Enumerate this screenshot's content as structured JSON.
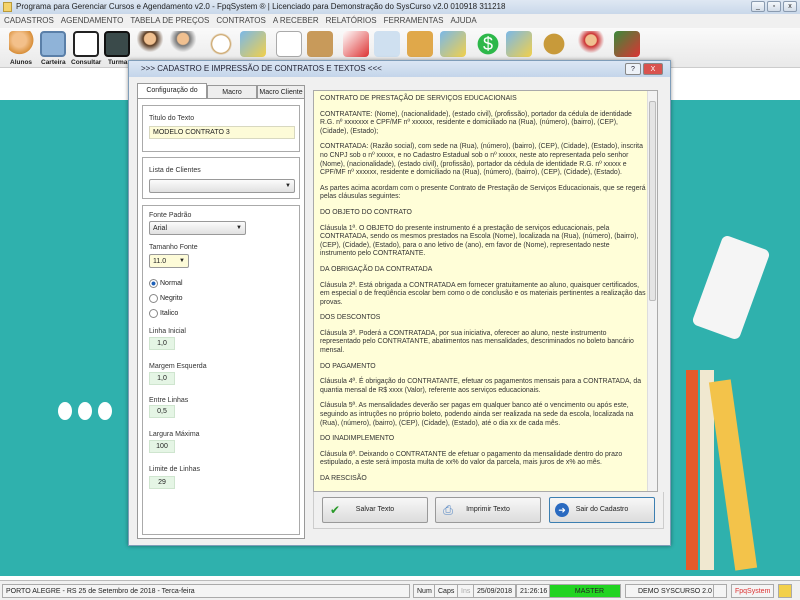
{
  "window": {
    "title": "Programa para Gerenciar Cursos e Agendamento v2.0 - FpqSystem ® | Licenciado para  Demonstração do SysCurso v2.0 010918 311218"
  },
  "menu": [
    "CADASTROS",
    "AGENDAMENTO",
    "TABELA DE PREÇOS",
    "CONTRATOS",
    "A RECEBER",
    "RELATÓRIOS",
    "FERRAMENTAS",
    "AJUDA"
  ],
  "toolbar": {
    "labels": [
      "Alunos",
      "Carteira",
      "Consultar",
      "Turma"
    ]
  },
  "dialog": {
    "title": ">>>  CADASTRO E IMPRESSÃO DE CONTRATOS E TEXTOS  <<<",
    "help": "?",
    "close": "X",
    "tabs": [
      "Configuração do Texto",
      "Macro Empresa",
      "Macro Cliente"
    ],
    "titulo_label": "Titulo do Texto",
    "titulo_value": "MODELO CONTRATO 3",
    "clientes_label": "Lista de Clientes",
    "clientes_value": "",
    "fonte_label": "Fonte Padrão",
    "fonte_value": "Arial",
    "tamanho_label": "Tamanho Fonte",
    "tamanho_value": "11.0",
    "styles": [
      "Normal",
      "Negrito",
      "Italico"
    ],
    "linha_inicial_label": "Linha Inicial",
    "linha_inicial": "1,0",
    "margem_label": "Margem Esquerda",
    "margem": "1,0",
    "entre_label": "Entre Linhas",
    "entre": "0,5",
    "largura_label": "Largura Máxima",
    "largura": "100",
    "limite_label": "Limite de Linhas",
    "limite": "29",
    "text": [
      "CONTRATO DE PRESTAÇÃO DE SERVIÇOS EDUCACIONAIS",
      "CONTRATANTE: (Nome), (nacionalidade), (estado civil), (profissão), portador da cédula de identidade R.G. nº xxxxxxx e CPF/MF nº xxxxxx, residente e domiciliado na (Rua), (número), (bairro), (CEP), (Cidade), (Estado);",
      "CONTRATADA: (Razão social), com sede na (Rua), (número), (bairro), (CEP), (Cidade), (Estado), inscrita no CNPJ sob o nº xxxxx, e no Cadastro Estadual sob o nº xxxxx, neste ato representada pelo senhor (Nome), (nacionalidade), (estado civil), (profissão), portador da cédula de identidade R.G. nº xxxxx e CPF/MF nº xxxxxx, residente e domiciliado na (Rua), (número), (bairro), (CEP), (Cidade), (Estado).",
      "As partes acima acordam com o presente Contrato de Prestação de Serviços Educacionais, que se regerá pelas cláusulas seguintes:",
      "DO OBJETO DO CONTRATO",
      "Cláusula 1ª. O OBJETO do presente instrumento é a prestação de serviços educacionais, pela CONTRATADA, sendo os mesmos prestados na Escola (Nome), localizada na (Rua), (número), (bairro), (CEP), (Cidade), (Estado), para o ano letivo de (ano), em favor de (Nome), representado neste instrumento pelo CONTRATANTE.",
      "DA OBRIGAÇÃO DA CONTRATADA",
      "Cláusula 2ª. Está obrigada a CONTRATADA em fornecer gratuitamente ao aluno, quaisquer certificados, em especial o de freqüência escolar bem como o de conclusão e os materiais pertinentes a realização das provas.",
      "DOS DESCONTOS",
      "Cláusula 3ª. Poderá a CONTRATADA, por sua iniciativa, oferecer ao aluno, neste instrumento representado pelo CONTRATANTE, abatimentos nas mensalidades, descriminados no boleto bancário mensal.",
      "DO PAGAMENTO",
      "Cláusula 4ª. É obrigação do CONTRATANTE, efetuar os pagamentos mensais para a CONTRATADA, da quantia mensal de R$ xxxx (Valor), referente aos serviços educacionais.",
      "Cláusula 5ª. As mensalidades deverão ser pagas em qualquer banco até o vencimento ou após este, seguindo as intruções no próprio boleto, podendo ainda ser realizada na sede da escola, localizada na (Rua), (número), (bairro), (CEP), (Cidade), (Estado), até o dia xx de cada mês.",
      "DO INADIMPLEMENTO",
      "Cláusula 6ª. Deixando o CONTRATANTE de efetuar o pagamento da mensalidade dentro do prazo estipulado, a este será imposta multa de xx% do valor da parcela, mais juros de x% ao mês.",
      "DA RESCISÃO"
    ],
    "buttons": {
      "save": "Salvar Texto",
      "print": "Imprimir Texto",
      "exit": "Sair do Cadastro"
    }
  },
  "status": {
    "location": "PORTO ALEGRE - RS 25 de Setembro de 2018 - Terca-feira",
    "num": "Num",
    "caps": "Caps",
    "ins": "Ins",
    "date": "25/09/2018",
    "time": "21:26:16",
    "user": "MASTER",
    "db": "DEMO SYSCURSO 2.0",
    "brand": "FpqSystem"
  },
  "colors": {
    "teal": "#2fb1ad",
    "master": "#22d422"
  }
}
